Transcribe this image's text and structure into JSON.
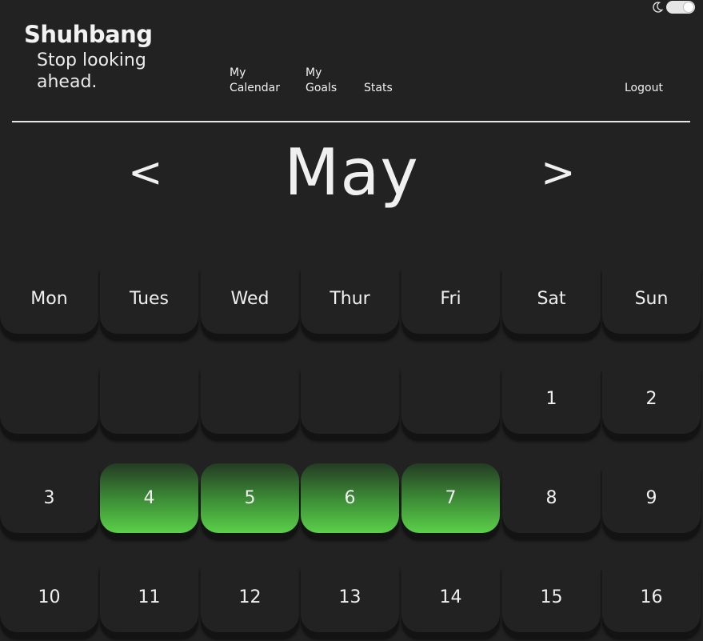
{
  "app": {
    "brand_name": "Shuhbang",
    "tagline": "Stop looking ahead."
  },
  "theme_toggle": {
    "icon": "moon-icon",
    "state": "on"
  },
  "nav": {
    "calendar": "My\nCalendar",
    "goals": "My\nGoals",
    "stats": "Stats",
    "logout": "Logout"
  },
  "calendar": {
    "month": "May",
    "prev_label": "<",
    "next_label": ">",
    "weekdays": [
      "Mon",
      "Tues",
      "Wed",
      "Thur",
      "Fri",
      "Sat",
      "Sun"
    ],
    "weeks": [
      [
        "",
        "",
        "",
        "",
        "",
        "1",
        "2"
      ],
      [
        "3",
        "4",
        "5",
        "6",
        "7",
        "8",
        "9"
      ],
      [
        "10",
        "11",
        "12",
        "13",
        "14",
        "15",
        "16"
      ]
    ],
    "highlighted_days": [
      "4",
      "5",
      "6",
      "7"
    ],
    "highlight_color": "#5bd04a"
  }
}
